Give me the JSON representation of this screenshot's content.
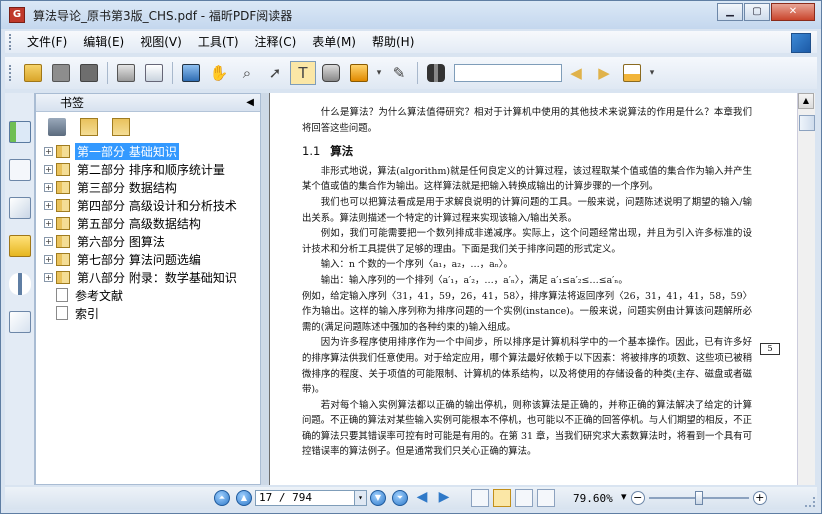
{
  "window": {
    "title": "算法导论_原书第3版_CHS.pdf - 福昕PDF阅读器"
  },
  "menubar": {
    "items": [
      "文件(F)",
      "编辑(E)",
      "视图(V)",
      "工具(T)",
      "注释(C)",
      "表单(M)",
      "帮助(H)"
    ]
  },
  "toolbar": {
    "icons": [
      "open-folder-icon",
      "save-icon",
      "save-as-icon",
      "print-icon",
      "scan-icon",
      "fullscreen-icon",
      "hand-tool-icon",
      "zoom-tool-icon",
      "select-arrow-icon",
      "text-select-icon",
      "snapshot-icon",
      "rms-icon",
      "sign-icon",
      "find-binoculars-icon",
      "prev-result-icon",
      "next-result-icon",
      "highlight-icon"
    ],
    "search_value": ""
  },
  "bookmarks_panel": {
    "title": "书签",
    "items": [
      {
        "label": "第一部分 基础知识",
        "selected": true,
        "expandable": true
      },
      {
        "label": "第二部分 排序和顺序统计量",
        "expandable": true
      },
      {
        "label": "第三部分 数据结构",
        "expandable": true
      },
      {
        "label": "第四部分 高级设计和分析技术",
        "expandable": true
      },
      {
        "label": "第五部分 高级数据结构",
        "expandable": true
      },
      {
        "label": "第六部分 图算法",
        "expandable": true
      },
      {
        "label": "第七部分 算法问题选编",
        "expandable": true
      },
      {
        "label": "第八部分 附录：数学基础知识",
        "expandable": true
      },
      {
        "label": "参考文献",
        "expandable": false
      },
      {
        "label": "索引",
        "expandable": false
      }
    ]
  },
  "document": {
    "intro": "什么是算法？为什么算法值得研究？相对于计算机中使用的其他技术来说算法的作用是什么？本章我们将回答这些问题。",
    "section_num": "1.1",
    "section_title": "算法",
    "p1": "非形式地说，算法(algorithm)就是任何良定义的计算过程，该过程取某个值或值的集合作为输入并产生某个值或值的集合作为输出。这样算法就是把输入转换成输出的计算步骤的一个序列。",
    "p2": "我们也可以把算法看成是用于求解良说明的计算问题的工具。一般来说，问题陈述说明了期望的输入/输出关系。算法则描述一个特定的计算过程来实现该输入/输出关系。",
    "p3": "例如，我们可能需要把一个数列排成非递减序。实际上，这个问题经常出现，并且为引入许多标准的设计技术和分析工具提供了足够的理由。下面是我们关于排序问题的形式定义。",
    "input_line": "输入：n 个数的一个序列〈a₁，a₂，…，aₙ〉。",
    "output_line": "输出：输入序列的一个排列〈a′₁，a′₂，…，a′ₙ〉，满足 a′₁≤a′₂≤…≤a′ₙ。",
    "p4": "例如，给定输入序列〈31，41，59，26，41，58〉，排序算法将返回序列〈26，31，41，41，58，59〉作为输出。这样的输入序列称为排序问题的一个实例(instance)。一般来说，问题实例由计算该问题解所必需的(满足问题陈述中强加的各种约束的)输入组成。",
    "p5": "因为许多程序使用排序作为一个中间步，所以排序是计算机科学中的一个基本操作。因此，已有许多好的排序算法供我们任意使用。对于给定应用，哪个算法最好依赖于以下因素：将被排序的项数、这些项已被稍微排序的程度、关于项值的可能限制、计算机的体系结构，以及将使用的存储设备的种类(主存、磁盘或者磁带)。",
    "p6": "若对每个输入实例算法都以正确的输出停机，则称该算法是正确的，并称正确的算法解决了给定的计算问题。不正确的算法对某些输入实例可能根本不停机，也可能以不正确的回答停机。与人们期望的相反，不正确的算法只要其错误率可控有时可能是有用的。在第 31 章，当我们研究求大素数算法时，将看到一个具有可控错误率的算法例子。但是通常我们只关心正确的算法。",
    "page_number": "5"
  },
  "statusbar": {
    "page_field": "17 / 794",
    "zoom": "79.60%",
    "zoom_level": 0.5
  }
}
